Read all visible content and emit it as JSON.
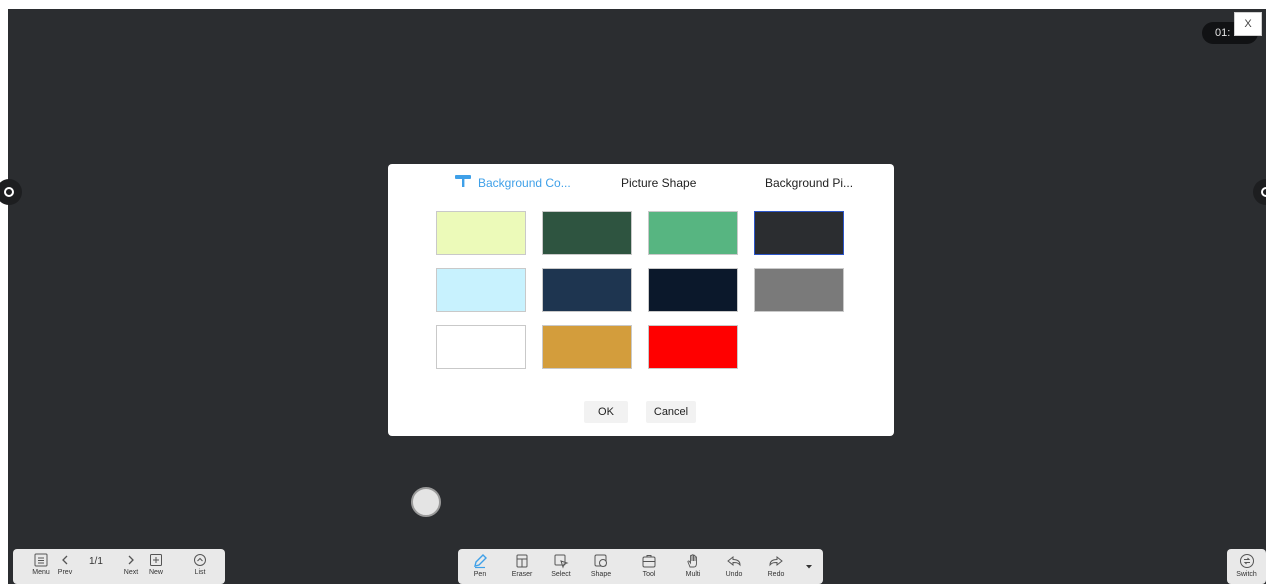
{
  "timer": {
    "text": "01:"
  },
  "close_button": {
    "label": "X"
  },
  "dialog": {
    "tabs": {
      "background_color": "Background Co...",
      "picture_shape": "Picture Shape",
      "background_picture": "Background Pi..."
    },
    "swatches": [
      "#ecfab9",
      "#2e5440",
      "#57b581",
      "#2b2d30",
      "#c8f2fe",
      "#1e3550",
      "#0b182b",
      "#7a7a7a",
      "#ffffff",
      "#d39d3c",
      "#ff0000"
    ],
    "selected_swatch_index": 3,
    "ok_label": "OK",
    "cancel_label": "Cancel"
  },
  "left_toolbar": {
    "menu_label": "Menu",
    "prev_label": "Prev",
    "page_indicator": "1/1",
    "next_label": "Next",
    "new_label": "New",
    "list_label": "List"
  },
  "center_toolbar": {
    "pen_label": "Pen",
    "eraser_label": "Eraser",
    "select_label": "Select",
    "shape_label": "Shape",
    "tool_label": "Tool",
    "multi_label": "Multi",
    "undo_label": "Undo",
    "redo_label": "Redo"
  },
  "right_toolbar": {
    "switch_label": "Switch"
  },
  "colors": {
    "accent": "#3fa0e8",
    "board": "#2b2d30"
  }
}
